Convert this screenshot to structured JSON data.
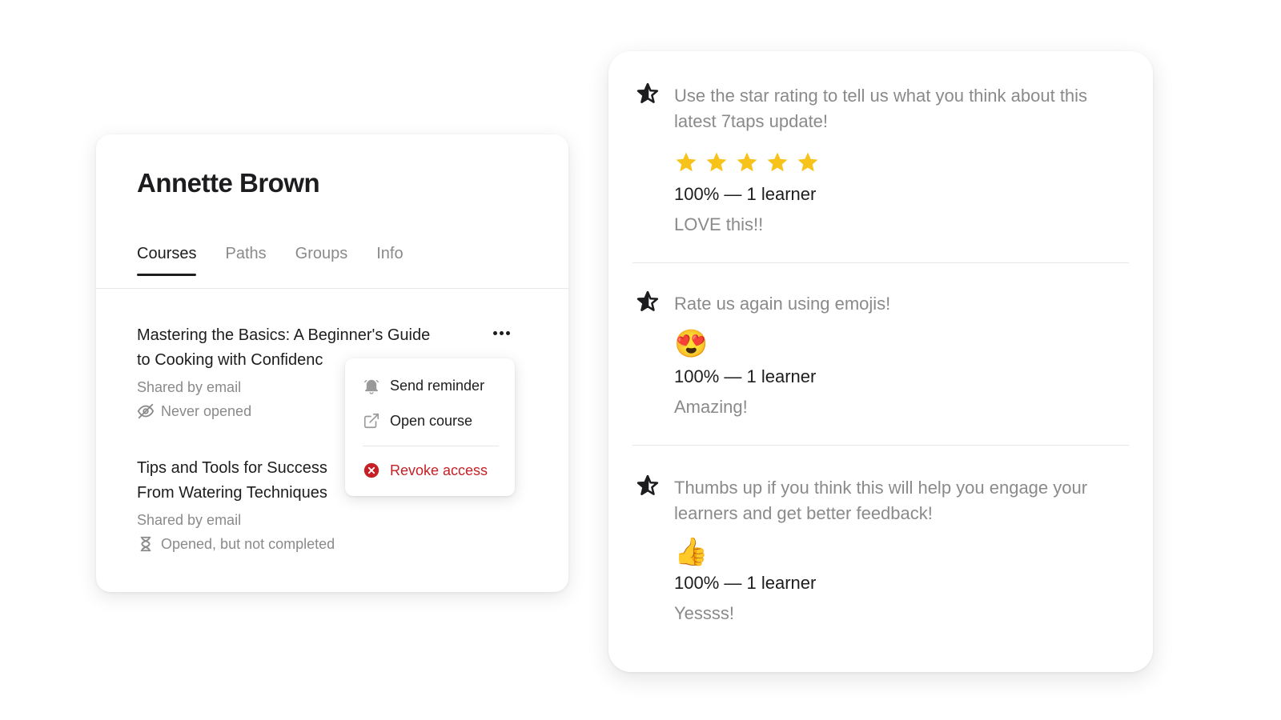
{
  "learner": {
    "name": "Annette Brown",
    "tabs": [
      {
        "label": "Courses",
        "active": true
      },
      {
        "label": "Paths",
        "active": false
      },
      {
        "label": "Groups",
        "active": false
      },
      {
        "label": "Info",
        "active": false
      }
    ],
    "courses": [
      {
        "title_line1": "Mastering the Basics: A Beginner's Guide",
        "title_line2": "to Cooking with Confidenc",
        "shared": "Shared by email",
        "status": "Never opened",
        "status_icon": "eye-off-icon"
      },
      {
        "title_line1": "Tips and Tools for Success",
        "title_line2": "From Watering Techniques",
        "shared": "Shared by email",
        "status": "Opened, but not completed",
        "status_icon": "hourglass-icon"
      }
    ],
    "menu": {
      "items": [
        {
          "label": "Send reminder",
          "icon": "bell-icon"
        },
        {
          "label": "Open course",
          "icon": "external-link-icon"
        }
      ],
      "danger": {
        "label": "Revoke access",
        "icon": "close-circle-icon"
      }
    }
  },
  "feedback": [
    {
      "question": "Use the star rating to tell us what you think about this latest 7taps update!",
      "type": "stars",
      "rating": 5,
      "max": 5,
      "result": "100% — 1 learner",
      "comment": "LOVE this!!"
    },
    {
      "question": "Rate us again using emojis!",
      "type": "emoji",
      "emoji": "😍",
      "result": "100% — 1 learner",
      "comment": "Amazing!"
    },
    {
      "question": "Thumbs up if you think this will help you engage your learners and get better feedback!",
      "type": "emoji",
      "emoji": "👍",
      "result": "100% — 1 learner",
      "comment": "Yessss!"
    }
  ],
  "colors": {
    "text": "#1d1d1f",
    "muted": "#8a8a8a",
    "danger": "#c62026",
    "star": "#f7c21a"
  }
}
